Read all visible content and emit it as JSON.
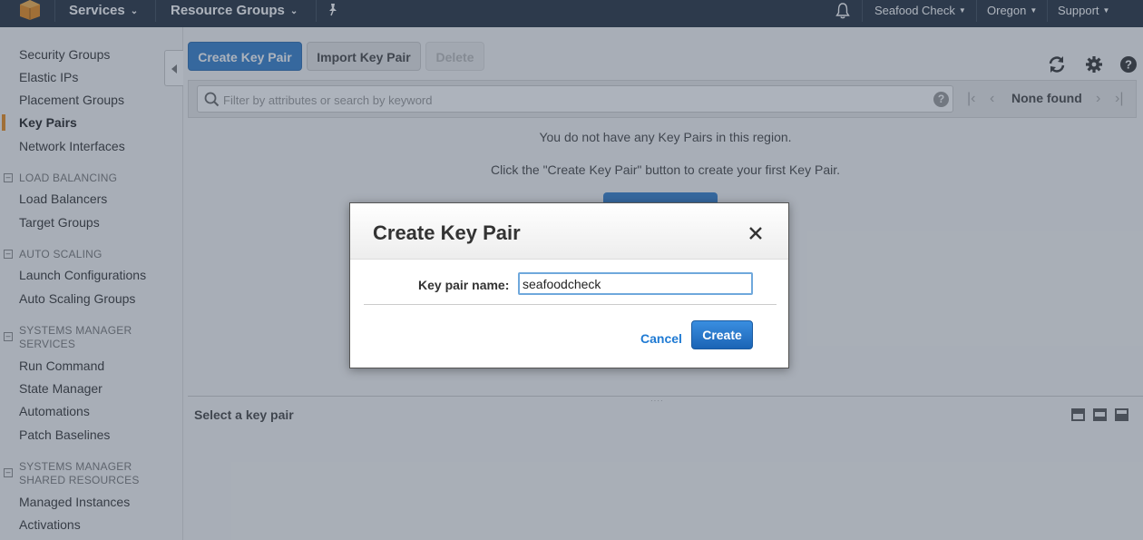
{
  "topnav": {
    "services_label": "Services",
    "resource_groups_label": "Resource Groups",
    "account_label": "Seafood Check",
    "region_label": "Oregon",
    "support_label": "Support"
  },
  "sidebar": {
    "items_top": [
      {
        "label": "Security Groups"
      },
      {
        "label": "Elastic IPs"
      },
      {
        "label": "Placement Groups"
      },
      {
        "label": "Key Pairs",
        "active": true
      },
      {
        "label": "Network Interfaces"
      }
    ],
    "sections": [
      {
        "heading": "LOAD BALANCING",
        "items": [
          "Load Balancers",
          "Target Groups"
        ]
      },
      {
        "heading": "AUTO SCALING",
        "items": [
          "Launch Configurations",
          "Auto Scaling Groups"
        ]
      },
      {
        "heading": "SYSTEMS MANAGER SERVICES",
        "heading_lines": [
          "SYSTEMS MANAGER",
          "SERVICES"
        ],
        "items": [
          "Run Command",
          "State Manager",
          "Automations",
          "Patch Baselines"
        ]
      },
      {
        "heading": "SYSTEMS MANAGER SHARED RESOURCES",
        "heading_lines": [
          "SYSTEMS MANAGER",
          "SHARED RESOURCES"
        ],
        "items": [
          "Managed Instances",
          "Activations"
        ]
      }
    ]
  },
  "toolbar": {
    "create_label": "Create Key Pair",
    "import_label": "Import Key Pair",
    "delete_label": "Delete"
  },
  "filter": {
    "placeholder": "Filter by attributes or search by keyword",
    "help_glyph": "?",
    "status": "None found"
  },
  "empty_state": {
    "line1": "You do not have any Key Pairs in this region.",
    "line2": "Click the \"Create Key Pair\" button to create your first Key Pair."
  },
  "details": {
    "title": "Select a key pair"
  },
  "modal": {
    "title": "Create Key Pair",
    "field_label": "Key pair name:",
    "field_value": "seafoodcheck",
    "cancel_label": "Cancel",
    "create_label": "Create"
  },
  "colors": {
    "topbar": "#232f3e",
    "primary": "#337ecc",
    "active_marker": "#e88a1a",
    "link": "#1f7ad3"
  }
}
